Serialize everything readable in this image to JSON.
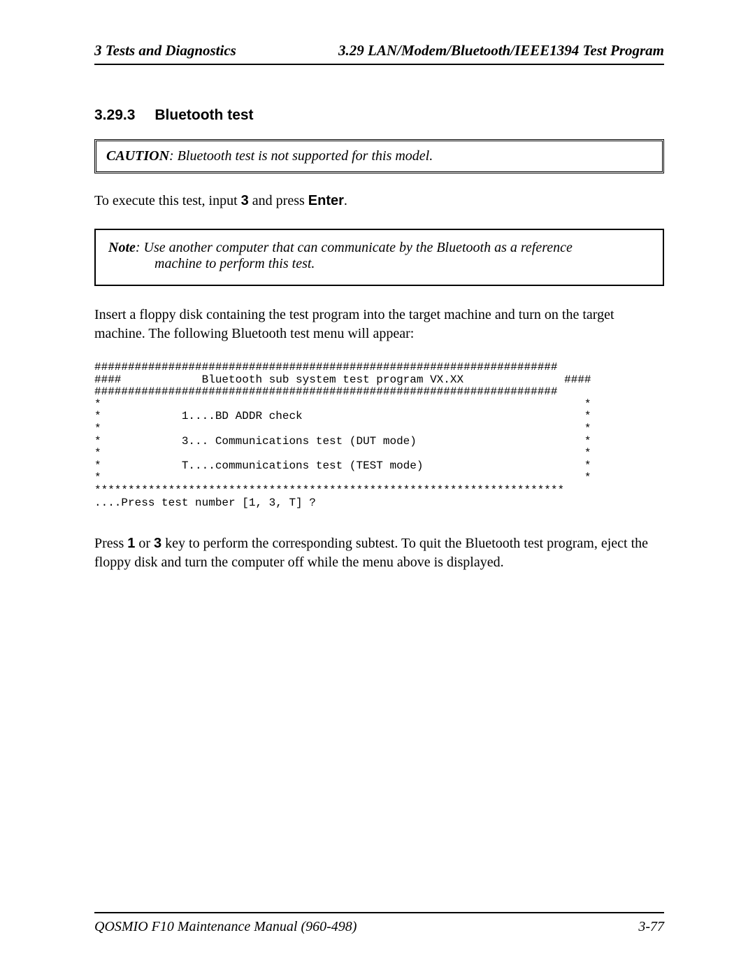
{
  "header": {
    "left": "3  Tests and Diagnostics",
    "right": "3.29  LAN/Modem/Bluetooth/IEEE1394 Test Program"
  },
  "section": {
    "number": "3.29.3",
    "title": "Bluetooth test"
  },
  "caution": {
    "label": "CAUTION",
    "text": ":  Bluetooth test is not supported for this model."
  },
  "intro": {
    "pre": "To execute this test, input ",
    "key1": "3",
    "mid": " and press ",
    "key2": "Enter",
    "post": "."
  },
  "note": {
    "label": "Note",
    "line1": ":   Use another computer that can communicate by the Bluetooth as a reference",
    "line2": "machine to perform this test."
  },
  "insert_text": "Insert a floppy disk containing the test program into the target machine and turn on the target machine. The following Bluetooth test menu will appear:",
  "terminal": "#####################################################################\n####            Bluetooth sub system test program VX.XX               ####\n#####################################################################\n*                                                                        *\n*            1....BD ADDR check                                          *\n*                                                                        *\n*            3... Communications test (DUT mode)                         *\n*                                                                        *\n*            T....communications test (TEST mode)                        *\n*                                                                        *\n**********************************************************************\n....Press test number [1, 3, T] ?",
  "closing": {
    "pre": "Press ",
    "key1": "1",
    "mid1": " or ",
    "key2": "3",
    "mid2": " key to perform the corresponding subtest. To quit the Bluetooth test program, eject the floppy disk and turn the computer off while the menu above is displayed."
  },
  "footer": {
    "left": "QOSMIO F10 Maintenance Manual (960-498)",
    "right": "3-77"
  }
}
